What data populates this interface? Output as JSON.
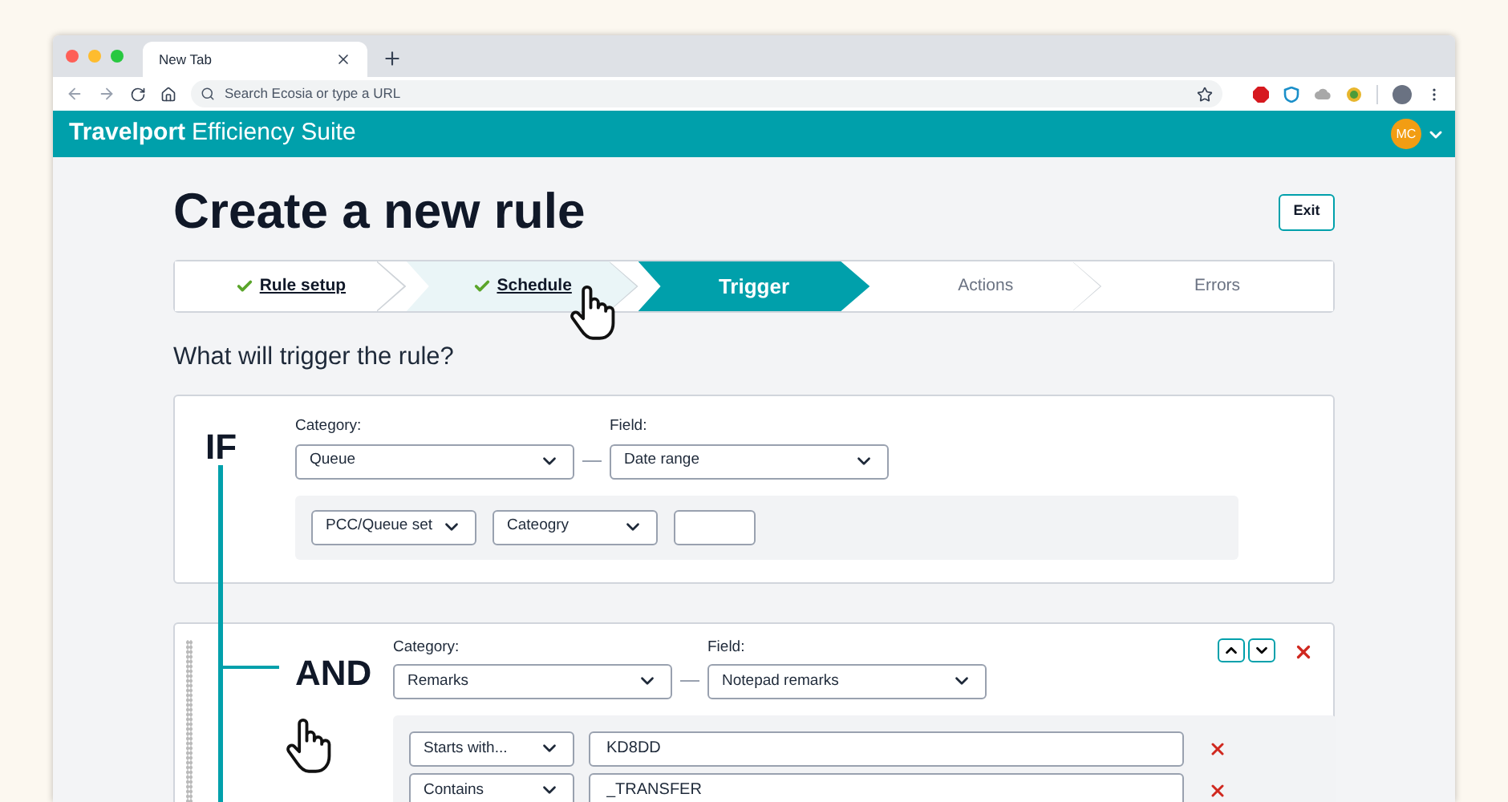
{
  "browser": {
    "tab_title": "New Tab",
    "address_placeholder": "Search Ecosia or type a URL"
  },
  "app_header": {
    "brand": "Travelport",
    "product": "Efficiency Suite",
    "avatar": "MC"
  },
  "page": {
    "title": "Create a new rule",
    "exit_button": "Exit",
    "question": "What will trigger the rule?"
  },
  "steps": [
    {
      "label": "Rule setup",
      "done": true,
      "selected": false,
      "hovered": false
    },
    {
      "label": "Schedule",
      "done": true,
      "selected": false,
      "hovered": true
    },
    {
      "label": "Trigger",
      "done": false,
      "selected": true,
      "hovered": false
    },
    {
      "label": "Actions",
      "done": false,
      "selected": false,
      "hovered": false
    },
    {
      "label": "Errors",
      "done": false,
      "selected": false,
      "hovered": false
    }
  ],
  "conditions": [
    {
      "kind": "if",
      "label": "IF",
      "category_label": "Category:",
      "category": "Queue",
      "field_label": "Field:",
      "field": "Date range",
      "reorder": false,
      "removable": false,
      "filters": [
        {
          "kind": "select",
          "value": "PCC/Queue set"
        },
        {
          "kind": "select",
          "value": "Cateogry"
        },
        {
          "kind": "input"
        }
      ]
    },
    {
      "kind": "and",
      "label": "AND",
      "category_label": "Category:",
      "category": "Remarks",
      "field_label": "Field:",
      "field": "Notepad remarks",
      "reorder": true,
      "removable": true,
      "rows": [
        {
          "operator": "Starts with...",
          "value": "KD8DD"
        },
        {
          "operator": "Contains",
          "value": "_TRANSFER"
        }
      ]
    }
  ]
}
